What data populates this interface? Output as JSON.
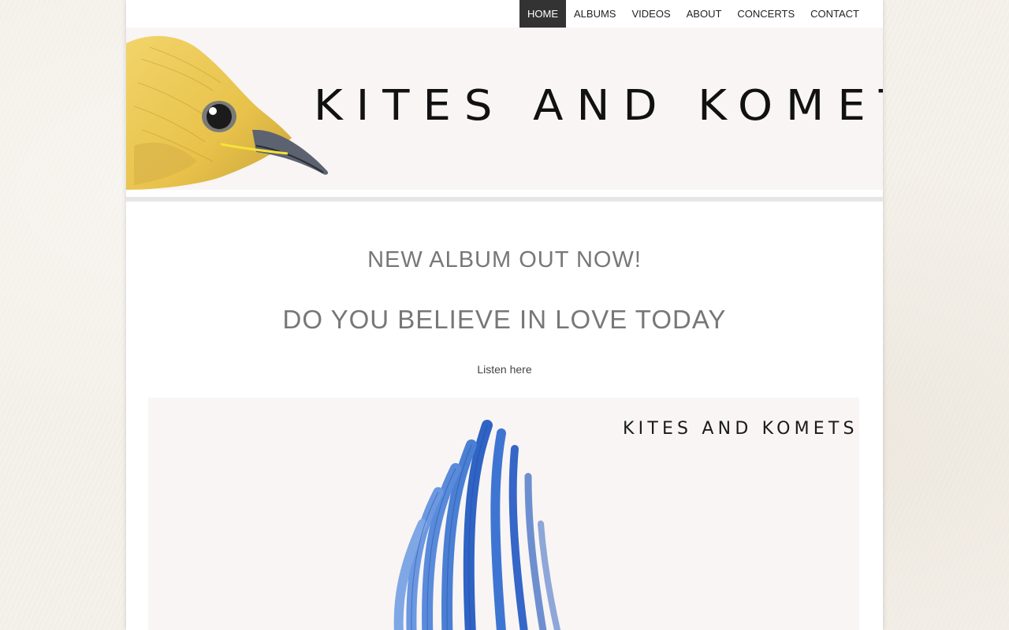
{
  "nav": {
    "items": [
      {
        "label": "HOME",
        "active": true
      },
      {
        "label": "ALBUMS",
        "active": false
      },
      {
        "label": "VIDEOS",
        "active": false
      },
      {
        "label": "ABOUT",
        "active": false
      },
      {
        "label": "CONCERTS",
        "active": false
      },
      {
        "label": "CONTACT",
        "active": false
      }
    ]
  },
  "header": {
    "band_name": "KITES AND KOMETS",
    "icon": "yellow-bird-illustration"
  },
  "main": {
    "headline": "NEW ALBUM OUT NOW!",
    "album_title": "DO YOU BELIEVE IN LOVE TODAY",
    "listen_link": "Listen here"
  },
  "album_cover": {
    "band_name": "KITES AND KOMETS",
    "icon": "blue-wing-illustration"
  },
  "colors": {
    "nav_active_bg": "#333333",
    "heading_text": "#777777",
    "banner_bg": "#f8f5f4",
    "wing_blue": "#4a7fd4"
  }
}
